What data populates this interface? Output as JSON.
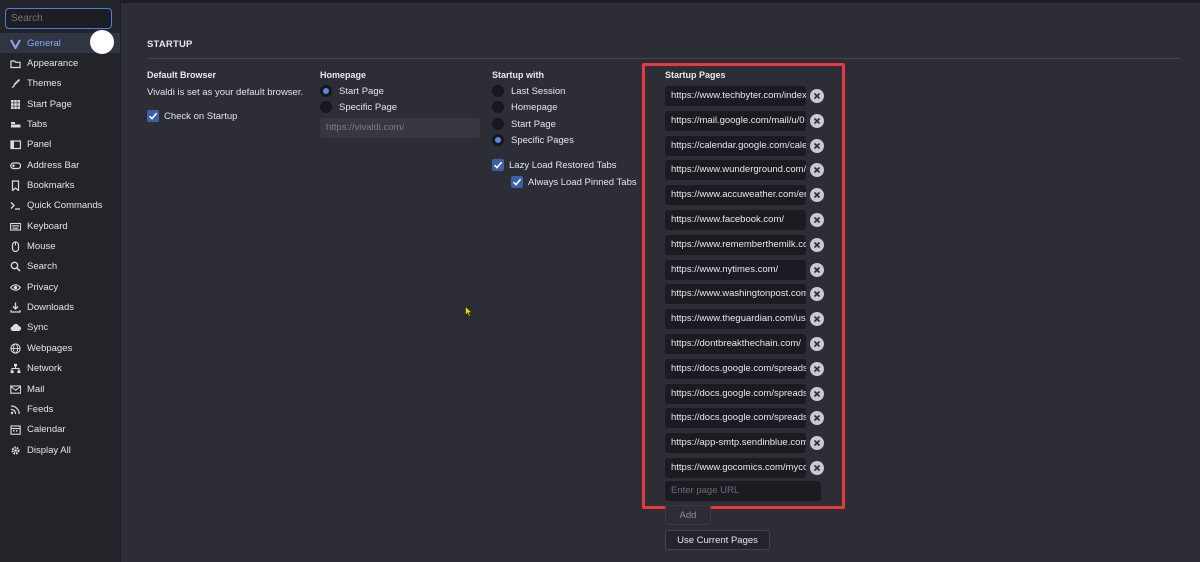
{
  "search": {
    "placeholder": "Search"
  },
  "sidebar": {
    "items": [
      {
        "label": "General",
        "icon": "vivaldi-v-icon",
        "active": true
      },
      {
        "label": "Appearance",
        "icon": "folder-icon"
      },
      {
        "label": "Themes",
        "icon": "brush-icon"
      },
      {
        "label": "Start Page",
        "icon": "grid-icon"
      },
      {
        "label": "Tabs",
        "icon": "tabs-icon"
      },
      {
        "label": "Panel",
        "icon": "panel-icon"
      },
      {
        "label": "Address Bar",
        "icon": "address-bar-icon"
      },
      {
        "label": "Bookmarks",
        "icon": "bookmark-icon"
      },
      {
        "label": "Quick Commands",
        "icon": "quick-commands-icon"
      },
      {
        "label": "Keyboard",
        "icon": "keyboard-icon"
      },
      {
        "label": "Mouse",
        "icon": "mouse-icon"
      },
      {
        "label": "Search",
        "icon": "search-icon"
      },
      {
        "label": "Privacy",
        "icon": "eye-icon"
      },
      {
        "label": "Downloads",
        "icon": "download-icon"
      },
      {
        "label": "Sync",
        "icon": "cloud-icon"
      },
      {
        "label": "Webpages",
        "icon": "globe-icon"
      },
      {
        "label": "Network",
        "icon": "network-icon"
      },
      {
        "label": "Mail",
        "icon": "mail-icon"
      },
      {
        "label": "Feeds",
        "icon": "rss-icon"
      },
      {
        "label": "Calendar",
        "icon": "calendar-icon"
      },
      {
        "label": "Display All",
        "icon": "gear-icon"
      }
    ]
  },
  "main": {
    "section_title": "STARTUP",
    "default_browser": {
      "title": "Default Browser",
      "status": "Vivaldi is set as your default browser.",
      "check_on_startup": {
        "label": "Check on Startup",
        "checked": true
      }
    },
    "homepage": {
      "title": "Homepage",
      "options": [
        {
          "label": "Start Page",
          "selected": true
        },
        {
          "label": "Specific Page",
          "selected": false
        }
      ],
      "url_placeholder": "https://vivaldi.com/"
    },
    "startup_with": {
      "title": "Startup with",
      "options": [
        {
          "label": "Last Session",
          "selected": false
        },
        {
          "label": "Homepage",
          "selected": false
        },
        {
          "label": "Start Page",
          "selected": false
        },
        {
          "label": "Specific Pages",
          "selected": true
        }
      ],
      "lazy_load": {
        "label": "Lazy Load Restored Tabs",
        "checked": true
      },
      "always_load_pinned": {
        "label": "Always Load Pinned Tabs",
        "checked": true
      }
    },
    "startup_pages": {
      "title": "Startup Pages",
      "urls": [
        "https://www.techbyter.com/index",
        "https://mail.google.com/mail/u/0",
        "https://calendar.google.com/calendar",
        "https://www.wunderground.com/",
        "https://www.accuweather.com/en",
        "https://www.facebook.com/",
        "https://www.rememberthemilk.com/",
        "https://www.nytimes.com/",
        "https://www.washingtonpost.com/",
        "https://www.theguardian.com/us",
        "https://dontbreakthechain.com/",
        "https://docs.google.com/spreadsheets",
        "https://docs.google.com/spreadsheets",
        "https://docs.google.com/spreadsheets",
        "https://app-smtp.sendinblue.com/",
        "https://www.gocomics.com/mycomics"
      ],
      "new_url_placeholder": "Enter page URL",
      "add_label": "Add",
      "use_current_label": "Use Current Pages"
    }
  },
  "colors": {
    "accent": "#4e7fe0",
    "highlight": "#e53a42",
    "background": "#2c2d35",
    "sidebar": "#23242a"
  }
}
